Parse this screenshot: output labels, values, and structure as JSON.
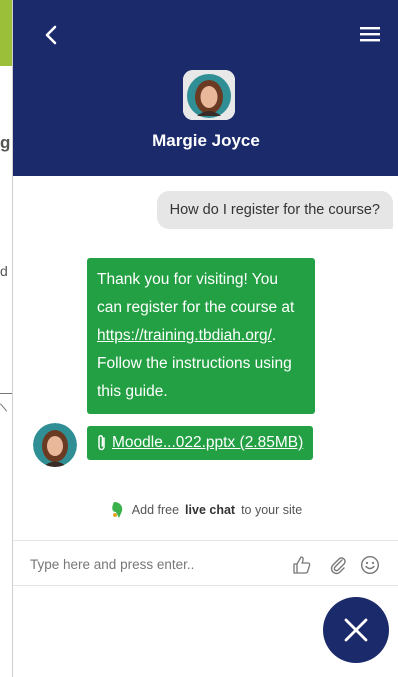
{
  "header": {
    "agent_name": "Margie Joyce"
  },
  "messages": {
    "user_question": "How do I register for the course?",
    "agent_reply_line1": "Thank you for visiting! You can register for the course at",
    "agent_reply_link": "https://training.tbdiah.org/",
    "agent_reply_line2": ". Follow the instructions using this guide.",
    "attachment_name": "Moodle...022.pptx (2.85MB)"
  },
  "footer": {
    "powered_prefix": "Add free",
    "powered_bold": "live chat",
    "powered_suffix": "to your site"
  },
  "composer": {
    "placeholder": "Type here and press enter.."
  },
  "background": {
    "char_g": "g",
    "char_d": "d"
  },
  "colors": {
    "header_bg": "#1b2a6b",
    "agent_bubble": "#23a043",
    "user_bubble": "#e6e6e6"
  }
}
